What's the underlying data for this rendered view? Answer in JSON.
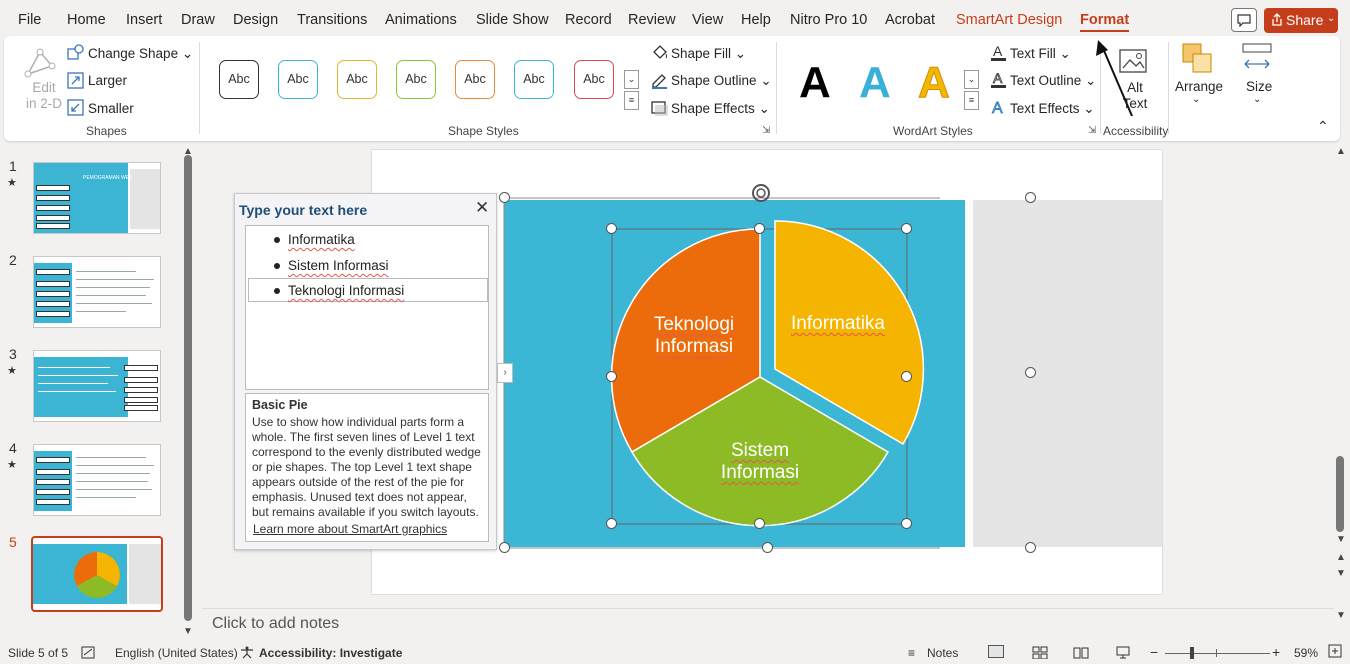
{
  "menu": {
    "items": [
      "File",
      "Home",
      "Insert",
      "Draw",
      "Design",
      "Transitions",
      "Animations",
      "Slide Show",
      "Record",
      "Review",
      "View",
      "Help",
      "Nitro Pro 10",
      "Acrobat",
      "SmartArt Design",
      "Format"
    ],
    "share_label": "Share"
  },
  "ribbon": {
    "shapes": {
      "edit_2d_label": "Edit\nin 2-D",
      "change_shape": "Change Shape",
      "larger": "Larger",
      "smaller": "Smaller",
      "group_label": "Shapes"
    },
    "shape_styles": {
      "style_label": "Abc",
      "colors": [
        "#333333",
        "#3bb7d5",
        "#e0b830",
        "#92c140",
        "#ec8a3a",
        "#3bb7d5",
        "#d9484e"
      ],
      "shape_fill": "Shape Fill",
      "shape_outline": "Shape Outline",
      "shape_effects": "Shape Effects",
      "group_label": "Shape Styles"
    },
    "wordart": {
      "letter": "A",
      "letter_colors": [
        "#000000",
        "#3ab0d8",
        "#f2b800"
      ],
      "text_fill": "Text Fill",
      "text_outline": "Text Outline",
      "text_effects": "Text Effects",
      "group_label": "WordArt Styles"
    },
    "accessibility": {
      "alt_text": "Alt Text",
      "group_label": "Accessibility"
    },
    "arrange": "Arrange",
    "size": "Size"
  },
  "slides": {
    "numbers": [
      "1",
      "2",
      "3",
      "4",
      "5"
    ],
    "slide1_title": "PEMOGRAMAN WEB",
    "active": "5"
  },
  "text_pane": {
    "title": "Type your text here",
    "items": [
      "Informatika",
      "Sistem Informasi",
      "Teknologi Informasi"
    ],
    "layout_name": "Basic Pie",
    "description": "Use to show how individual parts form a whole. The first seven lines of Level 1 text correspond to the evenly distributed wedge or pie shapes. The top Level 1 text shape appears outside of the rest of the pie for emphasis. Unused text does not appear, but remains available if you switch layouts.",
    "learn_more": "Learn more about SmartArt graphics"
  },
  "smartart": {
    "slices": [
      {
        "line1": "Informatika",
        "line2": "",
        "color": "#f5b400"
      },
      {
        "line1": "Sistem",
        "line2": "Informasi",
        "color": "#8dbb25"
      },
      {
        "line1": "Teknologi",
        "line2": "Informasi",
        "color": "#ec6c0b"
      }
    ],
    "slide_bg": "#3bb7d5"
  },
  "notes": {
    "placeholder": "Click to add notes"
  },
  "status_bar": {
    "slide_info": "Slide 5 of 5",
    "language": "English (United States)",
    "accessibility": "Accessibility: Investigate",
    "notes_label": "Notes",
    "zoom": "59%"
  }
}
